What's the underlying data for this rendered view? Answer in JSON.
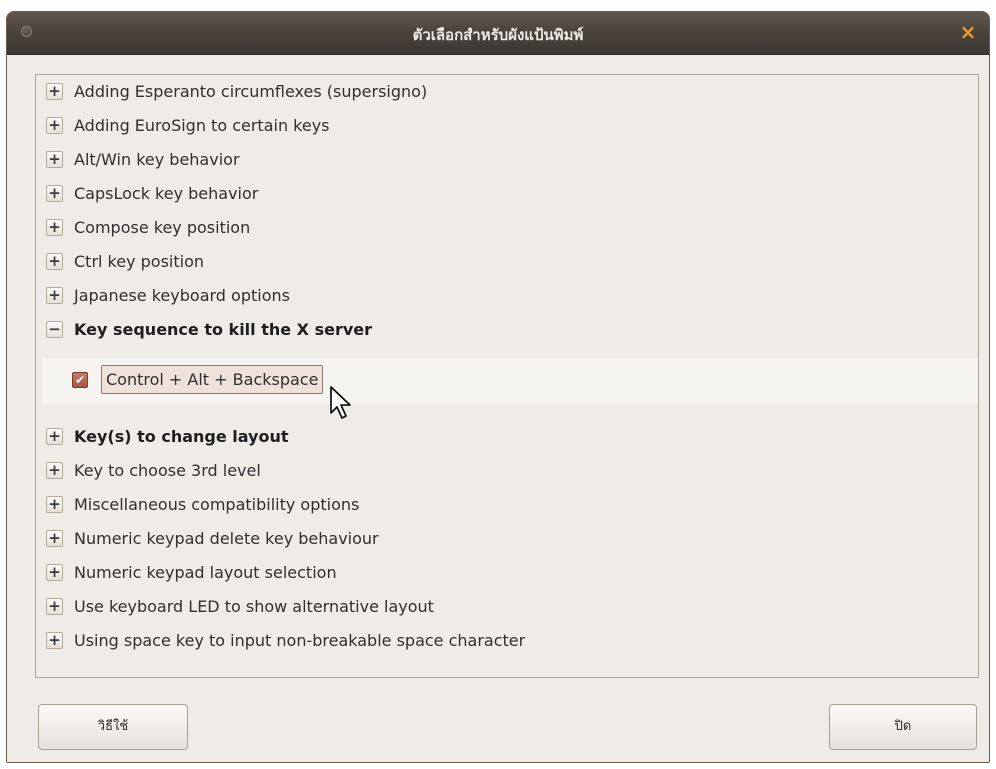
{
  "window": {
    "title": "ตัวเลือกสำหรับผังแป้นพิมพ์"
  },
  "tree": {
    "items_before": [
      {
        "label": "Adding Esperanto circumflexes (supersigno)",
        "expander": "+"
      },
      {
        "label": "Adding EuroSign to certain keys",
        "expander": "+"
      },
      {
        "label": "Alt/Win key behavior",
        "expander": "+"
      },
      {
        "label": "CapsLock key behavior",
        "expander": "+"
      },
      {
        "label": "Compose key position",
        "expander": "+"
      },
      {
        "label": "Ctrl key position",
        "expander": "+"
      },
      {
        "label": "Japanese keyboard options",
        "expander": "+"
      }
    ],
    "expanded_item": {
      "label": "Key sequence to kill the X server",
      "expander": "−",
      "option": {
        "label": "Control + Alt + Backspace",
        "checked": true,
        "check_glyph": "✔"
      }
    },
    "items_after": [
      {
        "label": "Key(s) to change layout",
        "expander": "+"
      },
      {
        "label": "Key to choose 3rd level",
        "expander": "+"
      },
      {
        "label": "Miscellaneous compatibility options",
        "expander": "+"
      },
      {
        "label": "Numeric keypad delete key behaviour",
        "expander": "+"
      },
      {
        "label": "Numeric keypad layout selection",
        "expander": "+"
      },
      {
        "label": "Use keyboard LED to show alternative layout",
        "expander": "+"
      },
      {
        "label": "Using space key to input non-breakable space character",
        "expander": "+"
      }
    ]
  },
  "buttons": {
    "help_label": "วิธีใช้",
    "close_label": "ปิด"
  },
  "icons": {
    "close": "×",
    "cursor": "arrow-pointer-icon"
  },
  "colors": {
    "titlebar": "#4a443d",
    "close_accent": "#f09a2a",
    "checkbox": "#a35744",
    "background": "#efebe7"
  }
}
